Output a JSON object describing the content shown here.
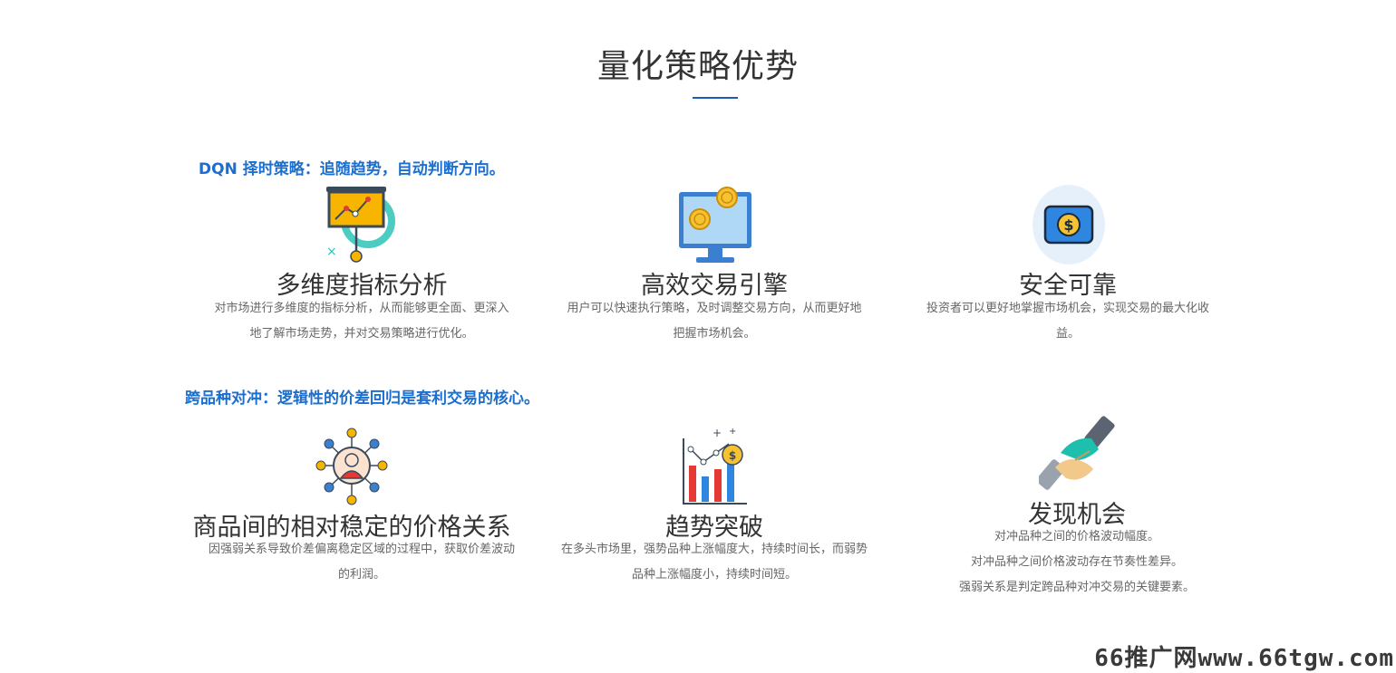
{
  "section": {
    "title": "量化策略优势"
  },
  "groups": [
    {
      "heading": "DQN 择时策略：追随趋势，自动判断方向。",
      "features": [
        {
          "icon": "presentation-chart-icon",
          "title": "多维度指标分析",
          "desc_lines": [
            "对市场进行多维度的指标分析，从而能够更全面、更深入",
            "地了解市场走势，并对交易策略进行优化。"
          ]
        },
        {
          "icon": "monitor-coins-icon",
          "title": "高效交易引擎",
          "desc_lines": [
            "用户可以快速执行策略，及时调整交易方向，从而更好地",
            "把握市场机会。"
          ]
        },
        {
          "icon": "dollar-wallet-icon",
          "title": "安全可靠",
          "desc_lines": [
            "投资者可以更好地掌握市场机会，实现交易的最大化收",
            "益。"
          ]
        }
      ]
    },
    {
      "heading": "跨品种对冲：逻辑性的价差回归是套利交易的核心。",
      "features": [
        {
          "icon": "network-person-icon",
          "title": "商品间的相对稳定的价格关系",
          "desc_lines": [
            "因强弱关系导致价差偏离稳定区域的过程中，获取价差波动",
            "的利润。"
          ]
        },
        {
          "icon": "bar-chart-coin-icon",
          "title": "趋势突破",
          "desc_lines": [
            "在多头市场里，强势品种上涨幅度大，持续时间长，而弱势",
            "品种上涨幅度小，持续时间短。"
          ]
        },
        {
          "icon": "handshake-icon",
          "title": "发现机会",
          "desc_lines": [
            "对冲品种之间的价格波动幅度。",
            "对冲品种之间价格波动存在节奏性差异。",
            "强弱关系是判定跨品种对冲交易的关键要素。"
          ]
        }
      ]
    }
  ],
  "watermark": "66推广网www.66tgw.com",
  "colors": {
    "accent": "#1a6fd0",
    "underline": "#1a5eb8",
    "title": "#333333",
    "desc": "#666666"
  }
}
